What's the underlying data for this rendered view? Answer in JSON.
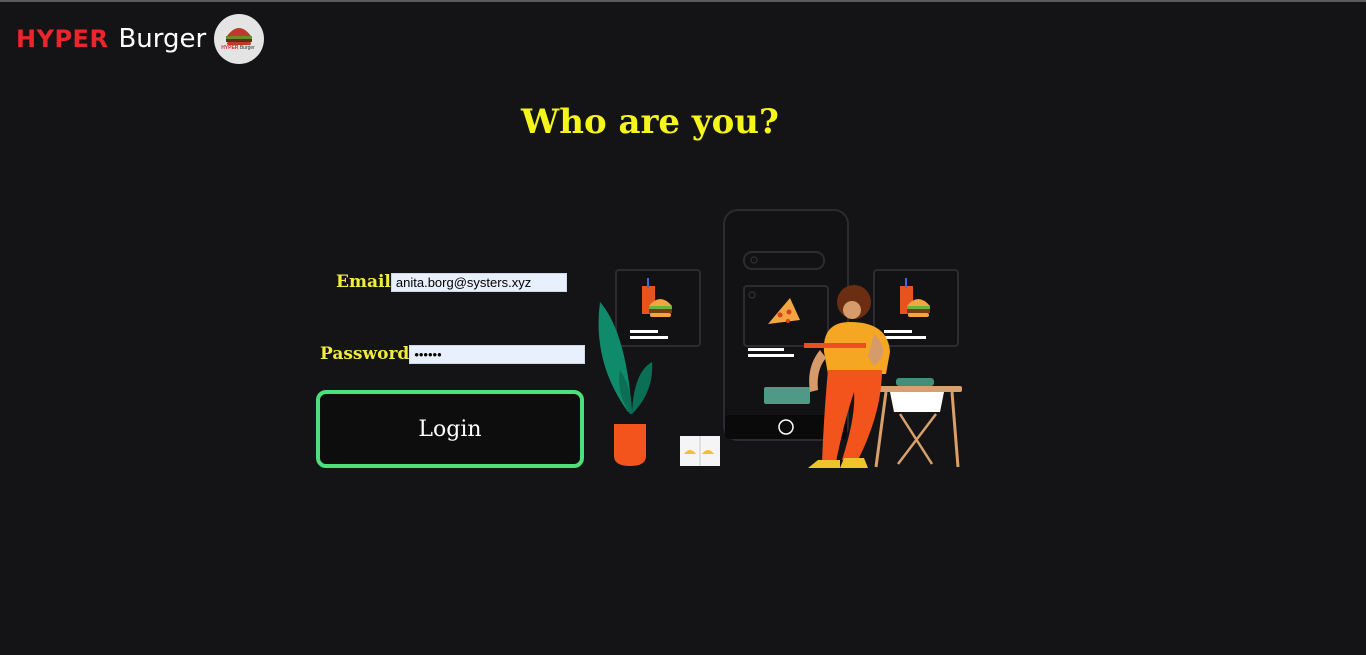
{
  "brand": {
    "hyper": "HYPER",
    "burger": "Burger",
    "logo_text_hyper": "HYPER",
    "logo_text_burger": "Burger",
    "logo_icon": "burger-logo-icon"
  },
  "page": {
    "title": "Who are you?"
  },
  "form": {
    "email_label": "Email",
    "email_value": "anita.borg@systers.xyz",
    "password_label": "Password",
    "password_value": "••••••",
    "login_label": "Login"
  },
  "illustration": {
    "name": "food-delivery-illustration"
  },
  "colors": {
    "background": "#141416",
    "title": "#f5f51a",
    "label": "#f2ec3c",
    "brand_red": "#e8262b",
    "button_border": "#4be07a"
  }
}
